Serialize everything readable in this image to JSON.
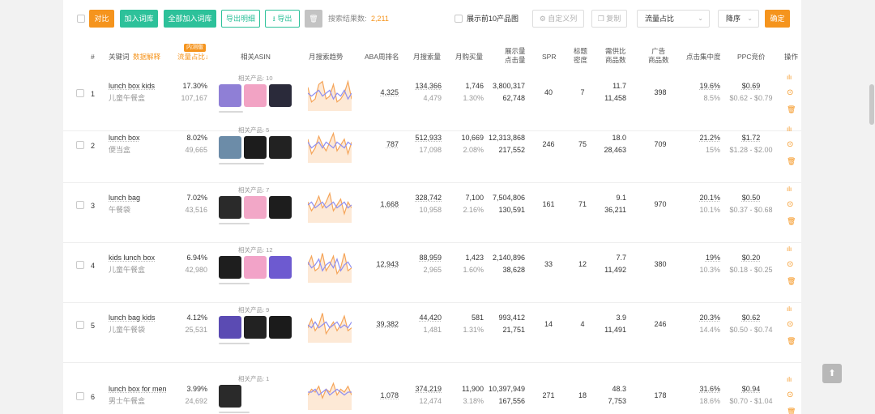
{
  "toolbar": {
    "compare": "对比",
    "add_to_library": "加入词库",
    "add_all_to_library": "全部加入词库",
    "export_details": "导出明细",
    "export": "导出",
    "result_label": "搜索结果数:",
    "result_count": "2,211",
    "show_top10": "展示前10产品图",
    "custom_columns": "自定义列",
    "copy": "复制",
    "sort_field": "流量占比",
    "sort_order": "降序",
    "confirm": "确定"
  },
  "header": {
    "index": "#",
    "keyword": "关键词",
    "data_explain": "数据解释",
    "traffic_share": "流量占比↓",
    "traffic_badge": "内测版",
    "asin": "相关ASIN",
    "trend": "月搜索趋势",
    "aba": "ABA周排名",
    "monthly_search": "月搜索量",
    "monthly_purchase": "月购买量",
    "impressions_l1": "展示量",
    "impressions_l2": "点击量",
    "spr": "SPR",
    "title_density_l1": "标题",
    "title_density_l2": "密度",
    "supply_demand_l1": "需供比",
    "supply_demand_l2": "商品数",
    "ad_products_l1": "广告",
    "ad_products_l2": "商品数",
    "click_concentration": "点击集中度",
    "ppc": "PPC竞价",
    "ops": "操作"
  },
  "rows": [
    {
      "index": "1",
      "keyword": "lunch box kids",
      "keyword_cn": "儿童午餐盒",
      "share": "17.30%",
      "share_sub": "107,167",
      "asin_label": "相关产品: 10",
      "aba": "4,325",
      "search": "134,366",
      "search_sub": "4,479",
      "purchase": "1,746",
      "purchase_rate": "1.30%",
      "impressions": "3,800,317",
      "clicks": "62,748",
      "spr": "40",
      "title_density": "7",
      "sd_ratio": "11.7",
      "sd_products": "11,458",
      "ad_products": "398",
      "concentration": "19.6%",
      "concentration_sub": "8.5%",
      "ppc": "$0.69",
      "ppc_range": "$0.62 - $0.79"
    },
    {
      "index": "2",
      "keyword": "lunch box",
      "keyword_cn": "便当盒",
      "share": "8.02%",
      "share_sub": "49,665",
      "asin_label": "相关产品: 5",
      "aba": "787",
      "search": "512,933",
      "search_sub": "17,098",
      "purchase": "10,669",
      "purchase_rate": "2.08%",
      "impressions": "12,313,868",
      "clicks": "217,552",
      "spr": "246",
      "title_density": "75",
      "sd_ratio": "18.0",
      "sd_products": "28,463",
      "ad_products": "709",
      "concentration": "21.2%",
      "concentration_sub": "15%",
      "ppc": "$1.72",
      "ppc_range": "$1.28 - $2.00"
    },
    {
      "index": "3",
      "keyword": "lunch bag",
      "keyword_cn": "午餐袋",
      "share": "7.02%",
      "share_sub": "43,516",
      "asin_label": "相关产品: 7",
      "aba": "1,668",
      "search": "328,742",
      "search_sub": "10,958",
      "purchase": "7,100",
      "purchase_rate": "2.16%",
      "impressions": "7,504,806",
      "clicks": "130,591",
      "spr": "161",
      "title_density": "71",
      "sd_ratio": "9.1",
      "sd_products": "36,211",
      "ad_products": "970",
      "concentration": "20.1%",
      "concentration_sub": "10.1%",
      "ppc": "$0.50",
      "ppc_range": "$0.37 - $0.68"
    },
    {
      "index": "4",
      "keyword": "kids lunch box",
      "keyword_cn": "儿童午餐盒",
      "share": "6.94%",
      "share_sub": "42,980",
      "asin_label": "相关产品: 12",
      "aba": "12,943",
      "search": "88,959",
      "search_sub": "2,965",
      "purchase": "1,423",
      "purchase_rate": "1.60%",
      "impressions": "2,140,896",
      "clicks": "38,628",
      "spr": "33",
      "title_density": "12",
      "sd_ratio": "7.7",
      "sd_products": "11,492",
      "ad_products": "380",
      "concentration": "19%",
      "concentration_sub": "10.3%",
      "ppc": "$0.20",
      "ppc_range": "$0.18 - $0.25"
    },
    {
      "index": "5",
      "keyword": "lunch bag kids",
      "keyword_cn": "儿童午餐袋",
      "share": "4.12%",
      "share_sub": "25,531",
      "asin_label": "相关产品: 9",
      "aba": "39,382",
      "search": "44,420",
      "search_sub": "1,481",
      "purchase": "581",
      "purchase_rate": "1.31%",
      "impressions": "993,412",
      "clicks": "21,751",
      "spr": "14",
      "title_density": "4",
      "sd_ratio": "3.9",
      "sd_products": "11,491",
      "ad_products": "246",
      "concentration": "20.3%",
      "concentration_sub": "14.4%",
      "ppc": "$0.62",
      "ppc_range": "$0.50 - $0.74"
    },
    {
      "index": "6",
      "keyword": "lunch box for men",
      "keyword_cn": "男士午餐盒",
      "share": "3.99%",
      "share_sub": "24,692",
      "asin_label": "相关产品: 1",
      "aba": "1,078",
      "search": "374,219",
      "search_sub": "12,474",
      "purchase": "11,900",
      "purchase_rate": "3.18%",
      "impressions": "10,397,949",
      "clicks": "167,556",
      "spr": "271",
      "title_density": "18",
      "sd_ratio": "48.3",
      "sd_products": "7,753",
      "ad_products": "178",
      "concentration": "31.6%",
      "concentration_sub": "18.6%",
      "ppc": "$0.94",
      "ppc_range": "$0.70 - $1.04"
    }
  ],
  "colors": {
    "accent": "#f5941d",
    "green": "#2dc19a",
    "trend_orange": "#f5a55a",
    "trend_purple": "#8f8ff0"
  },
  "icons": {
    "trend": "bar-chart-icon",
    "more": "more-circle-icon",
    "delete": "trash-icon",
    "top": "arrow-up-icon"
  }
}
